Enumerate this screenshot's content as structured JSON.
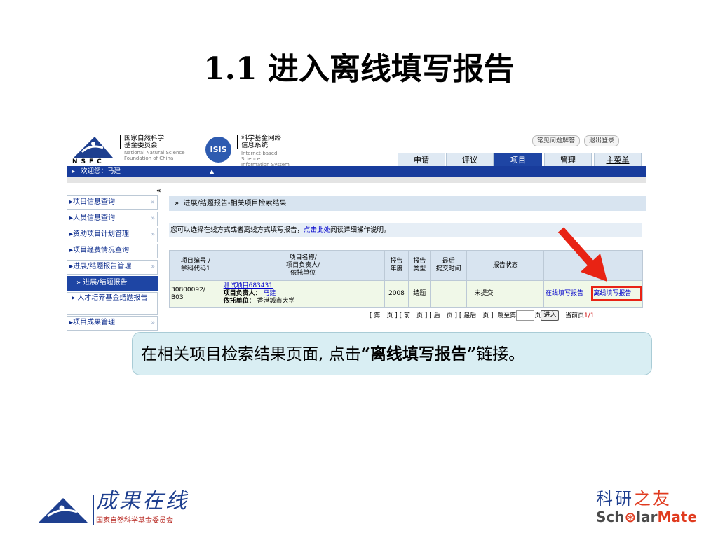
{
  "slide": {
    "title": "1.1 进入离线填写报告",
    "callout": {
      "prefix": "在相关项目检索结果页面, 点击",
      "emphasis": "“离线填写报告”",
      "suffix": "链接。"
    }
  },
  "header": {
    "nsfc_cn_line1": "国家自然科学",
    "nsfc_cn_line2": "基金委员会",
    "nsfc_en_line1": "National Natural Science",
    "nsfc_en_line2": "Foundation of China",
    "nsfc_letters": "NSFC",
    "isis_badge": "ISIS",
    "isis_cn_line1": "科学基金网络",
    "isis_cn_line2": "信息系统",
    "isis_en_line1": "Internet-based Science",
    "isis_en_line2": "Information System",
    "faq_button": "常见问题解答",
    "logout_button": "退出登录",
    "tabs": [
      {
        "label": "申请"
      },
      {
        "label": "评议"
      },
      {
        "label": "项目"
      },
      {
        "label": "管理"
      },
      {
        "label": "主菜单"
      }
    ],
    "welcome": "欢迎您：马建"
  },
  "sidebar": {
    "collapse_icon": "«",
    "items": [
      {
        "label": "项目信息查询"
      },
      {
        "label": "人员信息查询"
      },
      {
        "label": "资助项目计划管理"
      },
      {
        "label": "项目经费情况查询"
      },
      {
        "label": "进展/结题报告管理"
      },
      {
        "label": "进展/结题报告"
      },
      {
        "label": "人才培养基金结题报告"
      },
      {
        "label": "项目成果管理"
      }
    ]
  },
  "main": {
    "heading": "进展/结题报告-相关项目检索结果",
    "info_prefix": "您可以选择在线方式或者离线方式填写报告，",
    "info_link": "点击此处",
    "info_suffix": "阅读详细操作说明。",
    "table": {
      "headers": {
        "col1_line1": "项目编号 /",
        "col1_line2": "学科代码1",
        "col2_line1": "项目名称/",
        "col2_line2": "项目负责人/",
        "col2_line3": "依托单位",
        "col3_line1": "报告",
        "col3_line2": "年度",
        "col4_line1": "报告",
        "col4_line2": "类型",
        "col5_line1": "最后",
        "col5_line2": "提交时间",
        "col6": "报告状态",
        "col7": ""
      },
      "rows": [
        {
          "project_no": "30800092/",
          "discipline": "B03",
          "project_name": "测试项目683431",
          "leader_label": "项目负责人：",
          "leader": "马建",
          "org_label": "依托单位：",
          "org": "香港城市大学",
          "year": "2008",
          "type": "结题",
          "last_submit": "",
          "status": "未提交",
          "online_link": "在线填写报告",
          "offline_link": "离线填写报告"
        }
      ]
    },
    "pager": {
      "nav": "[ 第一页 ] [ 前一页 ] [ 后一页 ] [ 最后一页 ]",
      "jump_prefix": "跳至第",
      "jump_suffix": "页",
      "go_button": "进入",
      "current_label": "当前页",
      "current_value": "1/1"
    }
  },
  "footer": {
    "left_cn": "成果在线",
    "left_sub": "国家自然科学基金委员会",
    "right_cn_a": "科研",
    "right_cn_b": "之友",
    "right_en_a": "Sch",
    "right_en_b": "lar",
    "right_en_c": "Mate"
  },
  "colors": {
    "nav_blue": "#183c9c",
    "tab_active": "#1e45a4",
    "highlight_red": "#e82314",
    "callout_bg": "#d9eef3"
  }
}
